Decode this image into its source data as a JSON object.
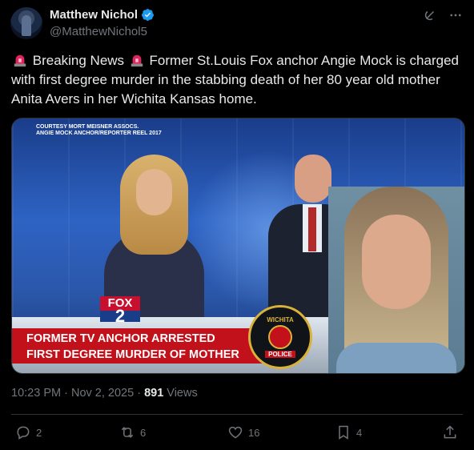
{
  "author": {
    "name": "Matthew Nichol",
    "handle": "@MatthewNichol5"
  },
  "tweet": {
    "text_parts": [
      "Breaking News",
      "Former St.Louis Fox anchor Angie Mock is charged with first degree murder in the stabbing death of her 80 year old mother Anita Avers in her Wichita Kansas home."
    ]
  },
  "media": {
    "courtesy_line1": "COURTESY MORT MEISNER ASSOCS.",
    "courtesy_line2": "ANGIE MOCK ANCHOR/REPORTER REEL 2017",
    "fox_logo": "FOX",
    "fox_channel": "2",
    "chyron_line1": "FORMER TV ANCHOR ARRESTED",
    "chyron_line2": "FIRST DEGREE MURDER OF MOTHER",
    "badge_top": "WICHITA",
    "badge_bottom": "POLICE"
  },
  "meta": {
    "time": "10:23 PM",
    "date": "Nov 2, 2025",
    "views_count": "891",
    "views_label": "Views"
  },
  "actions": {
    "replies": "2",
    "reposts": "6",
    "likes": "16",
    "bookmarks": "4"
  },
  "colors": {
    "background": "#000000",
    "text": "#e7e9ea",
    "muted": "#71767b",
    "verified": "#1d9bf0",
    "chyron": "#c2111b"
  }
}
